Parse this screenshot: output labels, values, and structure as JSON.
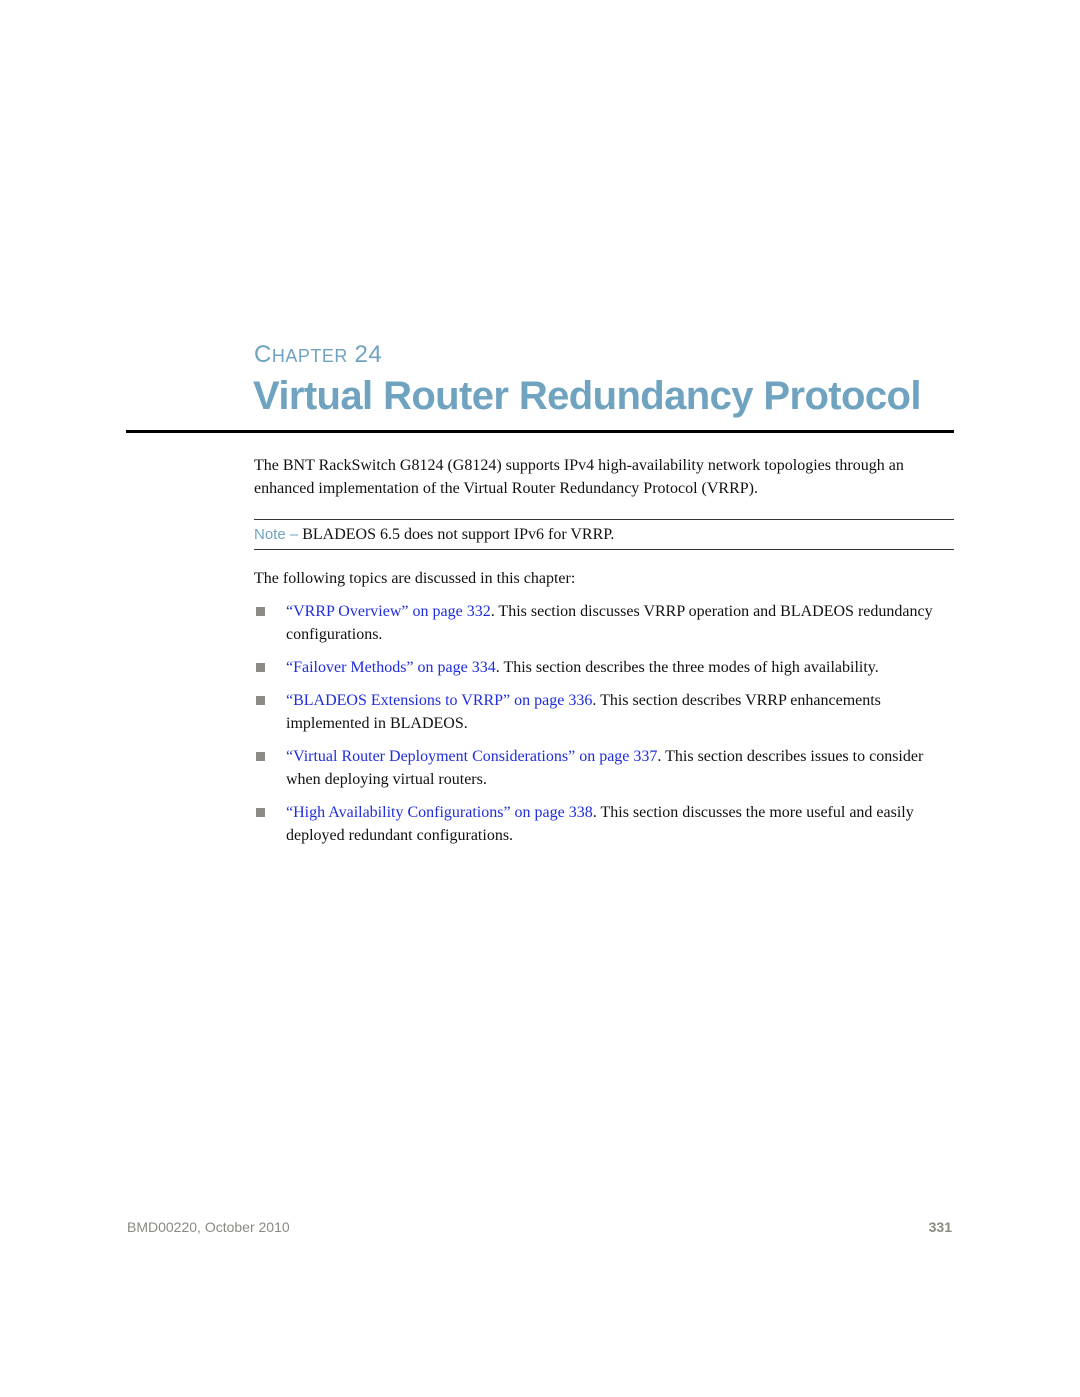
{
  "chapter": {
    "label_first": "C",
    "label_rest": "HAPTER",
    "number": "24",
    "title": "Virtual Router Redundancy Protocol"
  },
  "intro": "The BNT RackSwitch G8124 (G8124) supports IPv4 high-availability network topologies through an enhanced implementation of the Virtual Router Redundancy Protocol (VRRP).",
  "note": {
    "label": "Note –",
    "text": " BLADEOS 6.5 does not support IPv6 for VRRP."
  },
  "topics_intro": "The following topics are discussed in this chapter:",
  "topics": [
    {
      "link": "“VRRP Overview” on page 332",
      "description": ". This section discusses VRRP operation and BLADEOS redundancy configurations."
    },
    {
      "link": "“Failover Methods” on page 334",
      "description": ". This section describes the three modes of high availability."
    },
    {
      "link": "“BLADEOS Extensions to VRRP” on page 336",
      "description": ". This section describes VRRP enhancements implemented in BLADEOS."
    },
    {
      "link": "“Virtual Router Deployment Considerations” on page 337",
      "description": ". This section describes issues to consider when deploying virtual routers."
    },
    {
      "link": "“High Availability Configurations” on page 338",
      "description": ". This section discusses the more useful and easily deployed redundant configurations."
    }
  ],
  "footer": {
    "doc_id": "BMD00220, October 2010",
    "page_number": "331"
  },
  "colors": {
    "heading_accent": "#6fa3c0",
    "link": "#1f2ddc",
    "footer_text": "#8a8a80",
    "bullet": "#8c8c84"
  }
}
